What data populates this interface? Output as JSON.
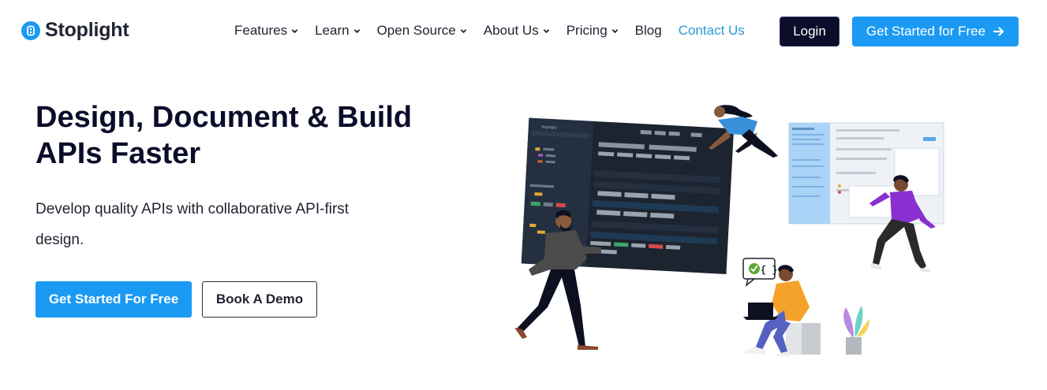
{
  "brand": {
    "name": "Stoplight",
    "accent": "#1a9af2",
    "dark": "#0b0d2a"
  },
  "nav": {
    "items": [
      {
        "label": "Features",
        "dropdown": true
      },
      {
        "label": "Learn",
        "dropdown": true
      },
      {
        "label": "Open Source",
        "dropdown": true
      },
      {
        "label": "About Us",
        "dropdown": true
      },
      {
        "label": "Pricing",
        "dropdown": true
      },
      {
        "label": "Blog",
        "dropdown": false
      },
      {
        "label": "Contact Us",
        "dropdown": false
      }
    ],
    "login_label": "Login",
    "cta_label": "Get Started for Free"
  },
  "hero": {
    "title_line1": "Design, Document & Build",
    "title_line2": "APIs Faster",
    "subtitle": "Develop quality APIs with collaborative API-first design.",
    "primary_button": "Get Started For Free",
    "secondary_button": "Book A Demo"
  },
  "illustration": {
    "app_logo": "Stoplight",
    "speech_bubble_text": "{ }"
  }
}
